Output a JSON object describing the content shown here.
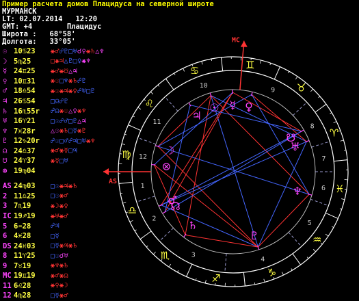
{
  "header": {
    "title": "Пример расчета домов Плацидуса на северной широте",
    "lines": [
      "МУРМАНСК",
      "LT: 02.07.2014   12:20",
      "GMT: +4        Плацидус",
      "Широта :   68°58'",
      "Долгота:   33°05'"
    ]
  },
  "colors": {
    "background": "#000000",
    "text": "#ffffff",
    "title": "#ffff00",
    "label": "#ff44ff",
    "position": "#ffff44",
    "red": "#ff3333",
    "blue": "#4466ff",
    "magenta": "#ff44ff",
    "yellow": "#ffff44",
    "ring": "#ffffff",
    "inner_ring": "#bbbbbb"
  },
  "planet_rows": [
    {
      "label": "☉",
      "pos": "10♋23",
      "aspects": [
        [
          "⚹♂",
          "red"
        ],
        [
          "☍♇",
          "blue"
        ],
        [
          "□♅",
          "blue"
        ],
        [
          "☌♀",
          "magenta"
        ],
        [
          "⚹♄",
          "red"
        ],
        [
          "△♆",
          "magenta"
        ]
      ]
    },
    {
      "label": "☽",
      "pos": "5♍25",
      "aspects": [
        [
          "□⚹♃",
          "red"
        ],
        [
          "△♇",
          "blue"
        ],
        [
          "□♀",
          "blue"
        ],
        [
          "⚹♆",
          "magenta"
        ]
      ]
    },
    {
      "label": "☿",
      "pos": "24♊25",
      "aspects": [
        [
          "⚹♂",
          "red"
        ],
        [
          "⚹☋",
          "red"
        ],
        [
          "△♃",
          "magenta"
        ]
      ]
    },
    {
      "label": "♀",
      "pos": "10♊31",
      "aspects": [
        [
          "⚹☉",
          "red"
        ],
        [
          "□♆",
          "blue"
        ],
        [
          "⚹♄",
          "red"
        ],
        [
          "☍♇",
          "blue"
        ]
      ]
    },
    {
      "label": "♂",
      "pos": "18♎54",
      "aspects": [
        [
          "⚹☉",
          "red"
        ],
        [
          "⚹♃",
          "red"
        ],
        [
          "⚹♀",
          "red"
        ],
        [
          "☍♅",
          "blue"
        ],
        [
          "□♇",
          "blue"
        ]
      ]
    },
    {
      "label": "♃",
      "pos": "26♋54",
      "aspects": [
        [
          "□☊",
          "blue"
        ],
        [
          "☍♇",
          "blue"
        ]
      ]
    },
    {
      "label": "♄",
      "pos": "16♏55r",
      "aspects": [
        [
          "☍☊",
          "blue"
        ],
        [
          "⚹☉",
          "red"
        ],
        [
          "△♀",
          "magenta"
        ],
        [
          "⚹♆",
          "red"
        ]
      ]
    },
    {
      "label": "♅",
      "pos": "16♈21",
      "aspects": [
        [
          "□☉",
          "blue"
        ],
        [
          "☍♂",
          "blue"
        ],
        [
          "□♇",
          "blue"
        ],
        [
          "△♃",
          "magenta"
        ]
      ]
    },
    {
      "label": "♆",
      "pos": "7♓28r",
      "aspects": [
        [
          "△☉",
          "magenta"
        ],
        [
          "⚹♄",
          "red"
        ],
        [
          "□☿",
          "blue"
        ],
        [
          "⚹♇",
          "red"
        ]
      ]
    },
    {
      "label": "♇",
      "pos": "12♑20r",
      "aspects": [
        [
          "☍☉",
          "blue"
        ],
        [
          "□♂",
          "blue"
        ],
        [
          "☍♃",
          "blue"
        ],
        [
          "□♅",
          "blue"
        ],
        [
          "⚹♆",
          "red"
        ]
      ]
    },
    {
      "label": "☊",
      "pos": "24♎37",
      "aspects": [
        [
          "⚹♂",
          "red"
        ],
        [
          "⚹☿",
          "red"
        ],
        [
          "□♃",
          "blue"
        ]
      ]
    },
    {
      "label": "☋",
      "pos": "24♈37",
      "aspects": [
        [
          "⚹☿",
          "red"
        ],
        [
          "□♅",
          "blue"
        ]
      ]
    },
    {
      "label": "⊗",
      "pos": "19♍04",
      "aspects": []
    }
  ],
  "house_rows": [
    {
      "label": "AS",
      "pos": "24♍03",
      "aspects": [
        [
          "□☉",
          "blue"
        ],
        [
          "⚹♃",
          "red"
        ],
        [
          "⚹♄",
          "red"
        ]
      ]
    },
    {
      "label": "2",
      "pos": "11♎25",
      "aspects": [
        [
          "□☉",
          "blue"
        ],
        [
          "⚹♂",
          "red"
        ]
      ]
    },
    {
      "label": "3",
      "pos": "7♏19",
      "aspects": [
        [
          "⚹☽",
          "red"
        ],
        [
          "⚹♀",
          "red"
        ]
      ]
    },
    {
      "label": "IC",
      "pos": "19♐19",
      "aspects": [
        [
          "⚹♅",
          "red"
        ],
        [
          "⚹♂",
          "red"
        ]
      ]
    },
    {
      "label": "5",
      "pos": "6♒28",
      "aspects": [
        [
          "☍♃",
          "blue"
        ]
      ]
    },
    {
      "label": "6",
      "pos": "4♓28",
      "aspects": [
        [
          "□☿",
          "blue"
        ]
      ]
    },
    {
      "label": "DS",
      "pos": "24♓03",
      "aspects": [
        [
          "□☿",
          "blue"
        ],
        [
          "⚹♃",
          "red"
        ],
        [
          "⚹♄",
          "red"
        ]
      ]
    },
    {
      "label": "8",
      "pos": "11♈25",
      "aspects": [
        [
          "□☉",
          "blue"
        ],
        [
          "☌♅",
          "magenta"
        ]
      ]
    },
    {
      "label": "9",
      "pos": "7♉19",
      "aspects": [
        [
          "⚹♆",
          "red"
        ],
        [
          "⚹♄",
          "red"
        ]
      ]
    },
    {
      "label": "MC",
      "pos": "19♊19",
      "aspects": [
        [
          "⚹♂",
          "red"
        ],
        [
          "⚹☊",
          "red"
        ]
      ]
    },
    {
      "label": "11",
      "pos": "6♌28",
      "aspects": [
        [
          "⚹♀",
          "red"
        ],
        [
          "⚹☽",
          "red"
        ]
      ]
    },
    {
      "label": "12",
      "pos": "4♍28",
      "aspects": [
        [
          "□☿",
          "blue"
        ],
        [
          "⚹♂",
          "red"
        ]
      ]
    }
  ],
  "wheel": {
    "mc_label": "MC",
    "as_label": "AS",
    "house_numbers": [
      "1",
      "2",
      "3",
      "4",
      "5",
      "6",
      "7",
      "8",
      "9",
      "10",
      "11",
      "12"
    ],
    "signs": [
      "♈",
      "♉",
      "♊",
      "♋",
      "♌",
      "♍",
      "♎",
      "♏",
      "♐",
      "♑",
      "♒",
      "♓"
    ],
    "planets": [
      {
        "glyph": "☉",
        "lon": 100.38
      },
      {
        "glyph": "☽",
        "lon": 155.42
      },
      {
        "glyph": "☿",
        "lon": 84.42
      },
      {
        "glyph": "♀",
        "lon": 70.52
      },
      {
        "glyph": "♂",
        "lon": 198.9
      },
      {
        "glyph": "♃",
        "lon": 116.9
      },
      {
        "glyph": "♄",
        "lon": 226.92
      },
      {
        "glyph": "♅",
        "lon": 16.35
      },
      {
        "glyph": "♆",
        "lon": 337.47
      },
      {
        "glyph": "♇",
        "lon": 282.33
      },
      {
        "glyph": "☊",
        "lon": 204.62
      },
      {
        "glyph": "☋",
        "lon": 24.62
      },
      {
        "glyph": "⊗",
        "lon": 169.07
      }
    ],
    "cusps": [
      174.05,
      191.42,
      217.32,
      259.32,
      306.47,
      334.47,
      354.05,
      11.42,
      37.32,
      79.32,
      126.47,
      154.47
    ]
  }
}
